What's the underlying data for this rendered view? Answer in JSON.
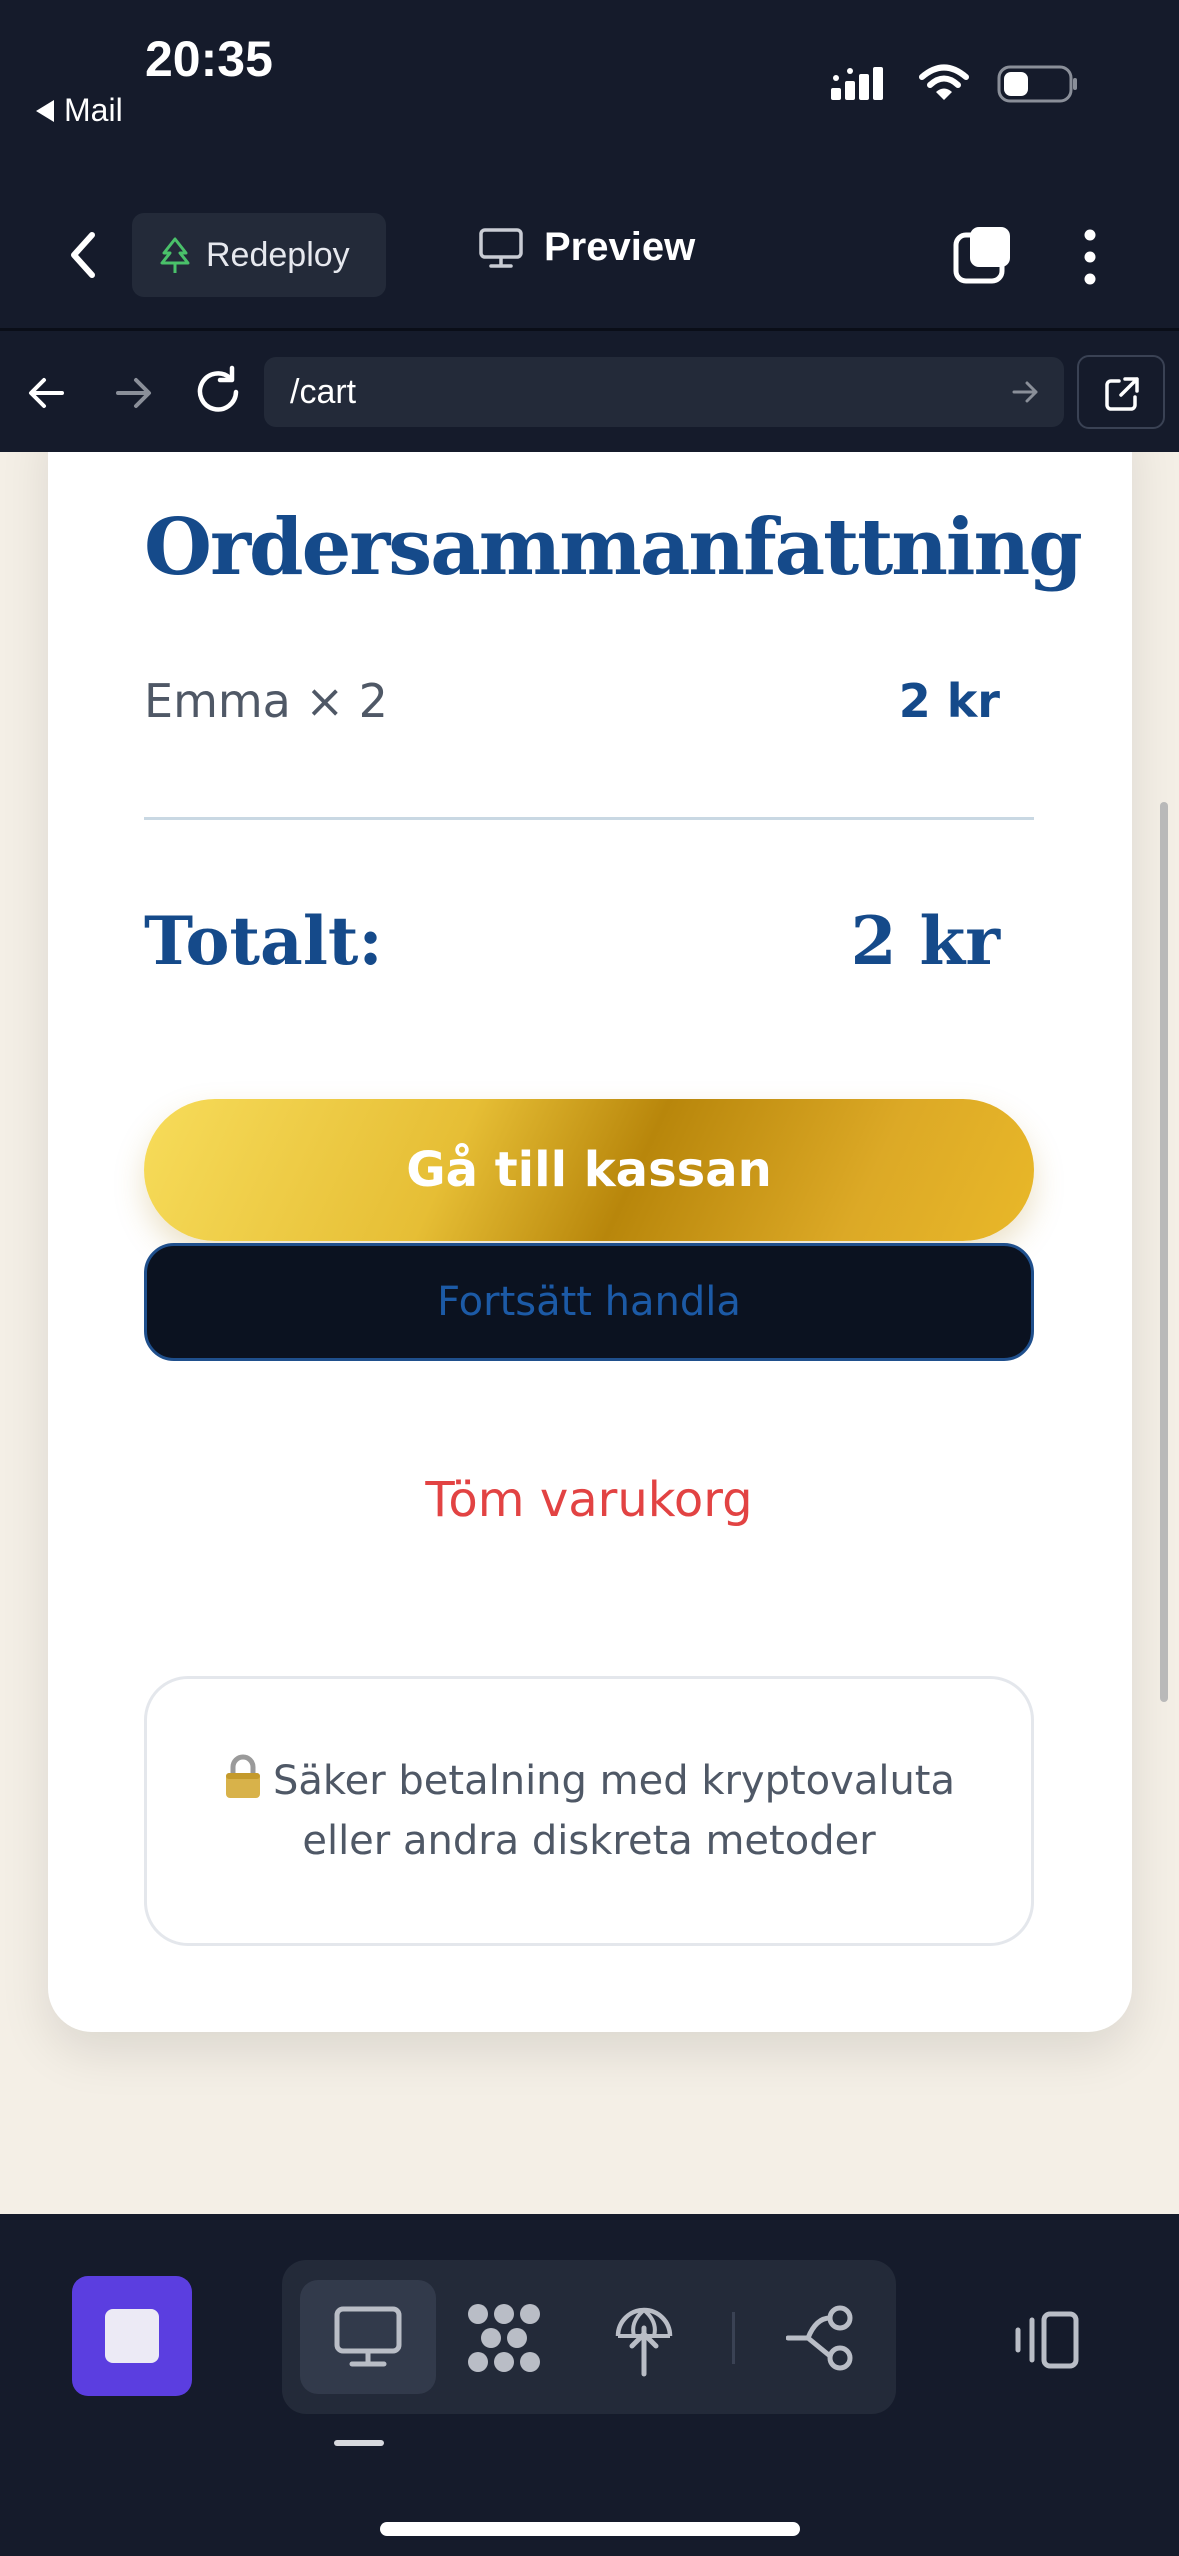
{
  "status_bar": {
    "time": "20:35",
    "back_app": "Mail"
  },
  "toolbar": {
    "redeploy_label": "Redeploy",
    "preview_label": "Preview"
  },
  "url_bar": {
    "path": "/cart"
  },
  "order_summary": {
    "title": "Ordersammanfattning",
    "items": [
      {
        "name": "Emma × 2",
        "price": "2 kr"
      }
    ],
    "total_label": "Totalt:",
    "total_value": "2 kr",
    "checkout_label": "Gå till kassan",
    "continue_label": "Fortsätt handla",
    "clear_label": "Töm varukorg",
    "secure_line1": "Säker betalning med kryptovaluta",
    "secure_line2": "eller andra diskreta metoder"
  },
  "colors": {
    "primary_blue": "#154a8a",
    "gold": "#e6be35",
    "danger": "#e24343",
    "accent_purple": "#5b3ee0",
    "chrome_bg": "#151b2b",
    "page_bg": "#f4efe6"
  },
  "bottom_bar": {
    "active_view": "desktop-preview",
    "icons": [
      "stop-icon",
      "desktop-icon",
      "grid-icon",
      "deploy-icon",
      "flow-icon",
      "panel-icon"
    ]
  }
}
